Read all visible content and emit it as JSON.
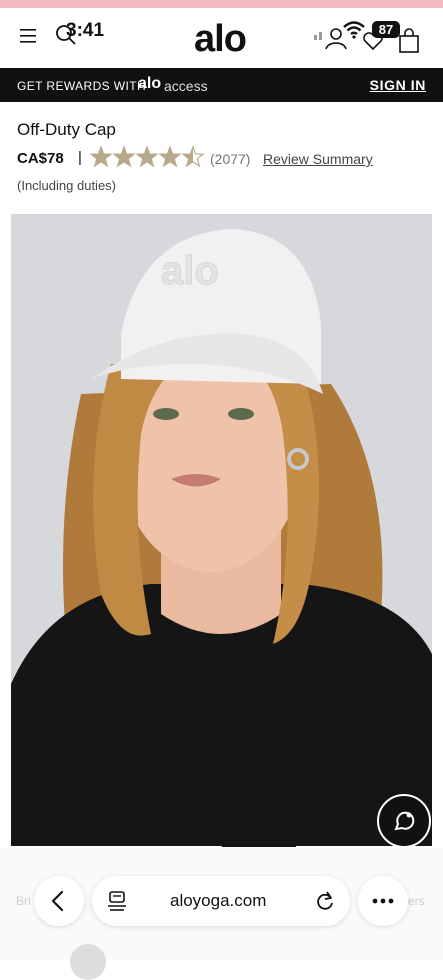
{
  "status": {
    "time": "3:41",
    "battery": "87"
  },
  "header": {
    "logo": "alo"
  },
  "rewards": {
    "text": "GET REWARDS WITH",
    "brand": "alo",
    "brand_sub": "access",
    "signin": "SIGN IN"
  },
  "product": {
    "title": "Off-Duty Cap",
    "price": "CA$78",
    "separator": "|",
    "rating": 4.5,
    "review_count": "(2077)",
    "review_link": "Review Summary",
    "duties_note": "(Including duties)"
  },
  "browser": {
    "url": "aloyoga.com",
    "faded_left": "Bri",
    "faded_right": "ers"
  },
  "colors": {
    "star": "#b8a98a",
    "black": "#111111",
    "pink": "#f2b8c4"
  },
  "icons": [
    "menu-icon",
    "search-icon",
    "account-icon",
    "heart-icon",
    "bag-icon",
    "wifi-icon",
    "star-icon",
    "chat-icon",
    "back-icon",
    "reader-icon",
    "reload-icon",
    "more-icon"
  ]
}
